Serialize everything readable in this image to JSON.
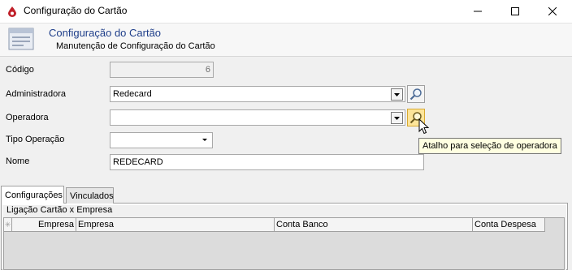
{
  "window": {
    "title": "Configuração do Cartão",
    "controls": [
      "minimize",
      "maximize",
      "close"
    ]
  },
  "header": {
    "title": "Configuração do Cartão",
    "subtitle": "Manutenção de Configuração do Cartão"
  },
  "form": {
    "codigo": {
      "label": "Código",
      "value": "6"
    },
    "administradora": {
      "label": "Administradora",
      "value": "Redecard"
    },
    "operadora": {
      "label": "Operadora",
      "value": ""
    },
    "tipo_operacao": {
      "label": "Tipo Operação",
      "value": ""
    },
    "nome": {
      "label": "Nome",
      "value": "REDECARD"
    }
  },
  "tooltip": "Atalho para seleção de operadora",
  "tabs": [
    "Configurações",
    "Vinculados"
  ],
  "group": {
    "title": "Ligação Cartão x Empresa",
    "columns": [
      "Empresa",
      "Empresa",
      "Conta Banco",
      "Conta Despesa"
    ]
  },
  "colors": {
    "header_title": "#1f3f8a",
    "tooltip_bg": "#ffffe1",
    "lookup_hot": "#fde59a"
  },
  "icons": [
    "app-logo-icon",
    "card-config-icon",
    "magnifier-icon",
    "mouse-cursor-icon"
  ]
}
